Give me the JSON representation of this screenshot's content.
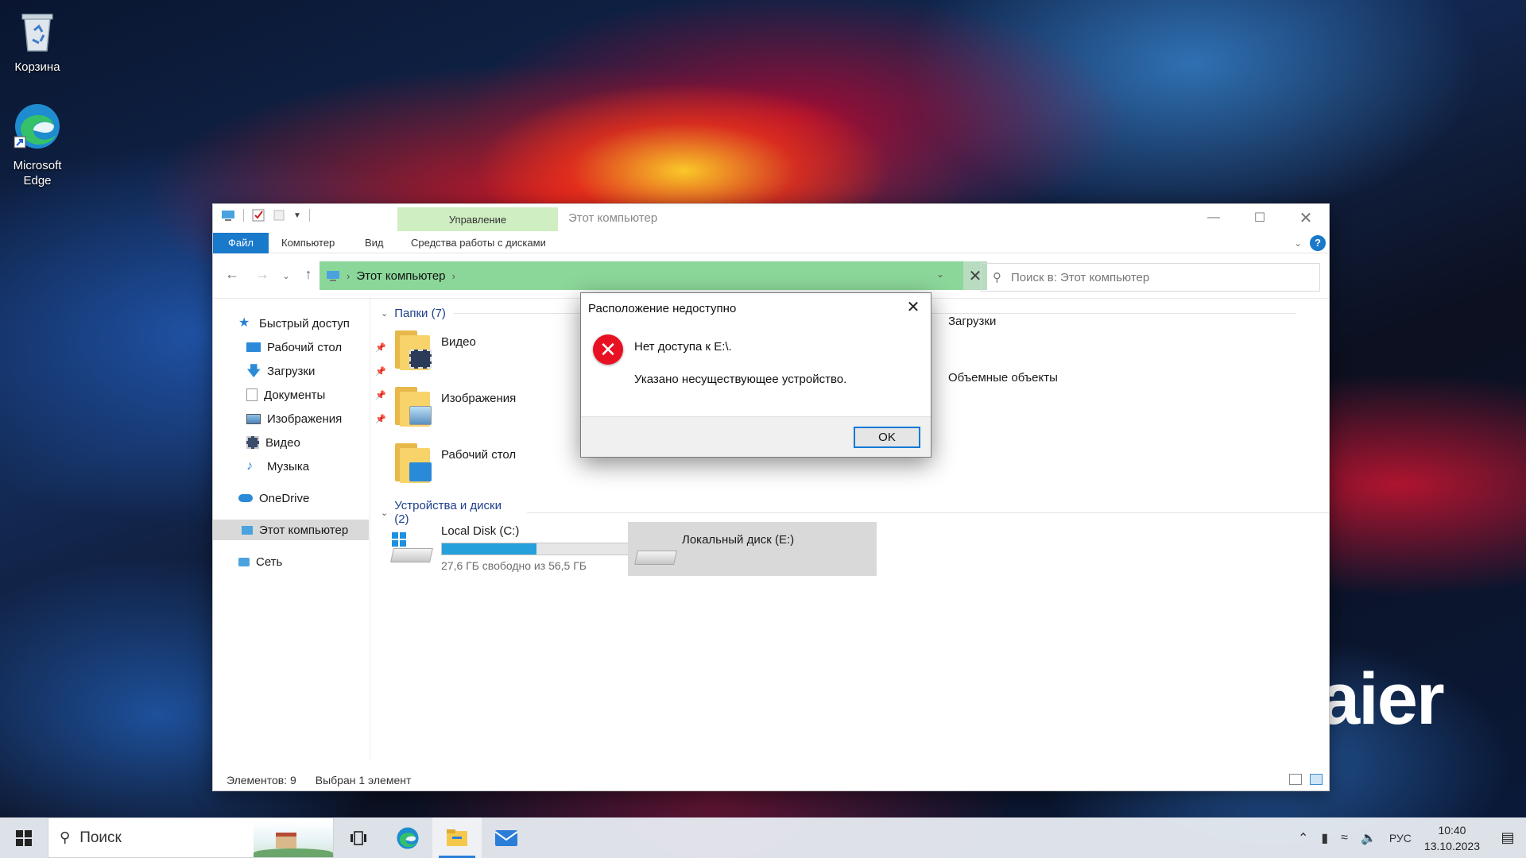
{
  "desktop": {
    "icons": [
      {
        "label": "Корзина",
        "icon": "recycle-bin-icon"
      },
      {
        "label": "Microsoft Edge",
        "icon": "edge-icon"
      }
    ],
    "brand_text": "aier"
  },
  "explorer": {
    "contextual_tab": "Управление",
    "title": "Этот компьютер",
    "ribbon_tabs": [
      "Файл",
      "Компьютер",
      "Вид",
      "Средства работы с дисками"
    ],
    "address": {
      "crumb": "Этот компьютер",
      "icon": "this-pc-icon"
    },
    "search_placeholder": "Поиск в: Этот компьютер",
    "nav_pane": [
      {
        "label": "Быстрый доступ",
        "icon": "star-icon",
        "pinned": false
      },
      {
        "label": "Рабочий стол",
        "icon": "desktop-icon",
        "pinned": true
      },
      {
        "label": "Загрузки",
        "icon": "download-icon",
        "pinned": true
      },
      {
        "label": "Документы",
        "icon": "documents-icon",
        "pinned": true
      },
      {
        "label": "Изображения",
        "icon": "images-icon",
        "pinned": true
      },
      {
        "label": "Видео",
        "icon": "video-icon",
        "pinned": false
      },
      {
        "label": "Музыка",
        "icon": "music-icon",
        "pinned": false
      },
      {
        "label": "OneDrive",
        "icon": "cloud-icon",
        "pinned": false
      },
      {
        "label": "Этот компьютер",
        "icon": "this-pc-icon",
        "pinned": false,
        "selected": true
      },
      {
        "label": "Сеть",
        "icon": "network-icon",
        "pinned": false
      }
    ],
    "folders_group": {
      "title": "Папки (7)",
      "items": [
        "Видео",
        "Изображения",
        "Рабочий стол",
        "Загрузки",
        "Объемные объекты"
      ]
    },
    "devices_group": {
      "title": "Устройства и диски (2)",
      "drives": [
        {
          "name": "Local Disk (C:)",
          "free_text": "27,6 ГБ свободно из 56,5 ГБ",
          "used_fraction": 0.51
        },
        {
          "name": "Локальный диск (E:)"
        }
      ]
    },
    "status": {
      "count": "Элементов: 9",
      "selection": "Выбран 1 элемент"
    }
  },
  "dialog": {
    "title": "Расположение недоступно",
    "message": "Нет доступа к E:\\.",
    "detail": "Указано несуществующее устройство.",
    "ok_label": "OK",
    "icon": "error-icon"
  },
  "taskbar": {
    "search_placeholder": "Поиск",
    "apps": [
      "task-view-icon",
      "edge-icon",
      "file-explorer-icon",
      "mail-icon"
    ],
    "language": "РУС",
    "time": "10:40",
    "date": "13.10.2023"
  }
}
